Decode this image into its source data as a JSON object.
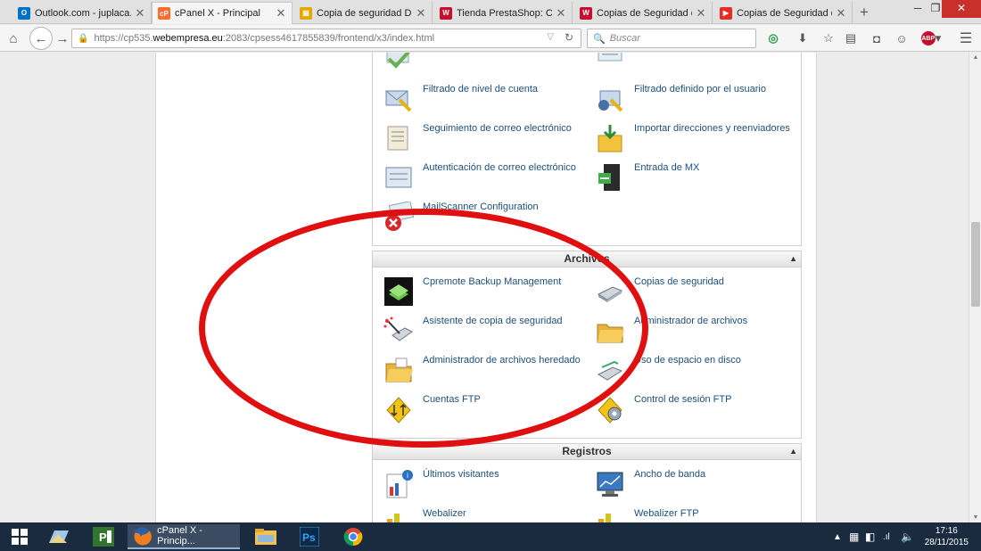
{
  "tabs": [
    {
      "title": "Outlook.com - juplaca...",
      "favicon": "outlook-icon",
      "color": "#0072c6",
      "glyph": "O"
    },
    {
      "title": "cPanel X - Principal",
      "favicon": "cpanel-icon",
      "color": "#ff6c2c",
      "glyph": "cP",
      "active": true
    },
    {
      "title": "Copia de seguridad DB ...",
      "favicon": "page-icon",
      "color": "#e0a800",
      "glyph": "▤"
    },
    {
      "title": "Tienda PrestaShop: Co...",
      "favicon": "webempresa-icon",
      "color": "#c8102e",
      "glyph": "W"
    },
    {
      "title": "Copias de Seguridad de...",
      "favicon": "webempresa-icon",
      "color": "#c8102e",
      "glyph": "W"
    },
    {
      "title": "Copias de Seguridad de...",
      "favicon": "youtube-icon",
      "color": "#e52d27",
      "glyph": "▶"
    }
  ],
  "browser": {
    "url_prefix": "https://cp535.",
    "url_host": "webempresa.eu",
    "url_rest": ":2083/cpsess4617855839/frontend/x3/index.html",
    "search_placeholder": "Buscar"
  },
  "email_section": {
    "items": [
      {
        "label": "Filtrado de nivel de cuenta",
        "icon": "filter-mail-icon"
      },
      {
        "label": "Filtrado definido por el usuario",
        "icon": "user-filter-icon"
      },
      {
        "label": "Seguimiento de correo electrónico",
        "icon": "mail-tracking-icon"
      },
      {
        "label": "Importar direcciones y reenviadores",
        "icon": "import-icon"
      },
      {
        "label": "Autenticación de correo electrónico",
        "icon": "mail-auth-icon"
      },
      {
        "label": "Entrada de MX",
        "icon": "mx-entry-icon"
      },
      {
        "label": "MailScanner Configuration",
        "icon": "mailscanner-icon"
      }
    ]
  },
  "archivos_section": {
    "title": "Archivos",
    "items": [
      {
        "label": "Cpremote Backup Management",
        "icon": "cpremote-backup-icon"
      },
      {
        "label": "Copias de seguridad",
        "icon": "backup-disk-icon"
      },
      {
        "label": "Asistente de copia de seguridad",
        "icon": "backup-wizard-icon"
      },
      {
        "label": "Administrador de archivos",
        "icon": "file-manager-icon"
      },
      {
        "label": "Administrador de archivos heredado",
        "icon": "legacy-file-manager-icon"
      },
      {
        "label": "Uso de espacio en disco",
        "icon": "disk-usage-icon"
      },
      {
        "label": "Cuentas FTP",
        "icon": "ftp-accounts-icon"
      },
      {
        "label": "Control de sesión FTP",
        "icon": "ftp-session-icon"
      }
    ]
  },
  "registros_section": {
    "title": "Registros",
    "items": [
      {
        "label": "Últimos visitantes",
        "icon": "latest-visitors-icon"
      },
      {
        "label": "Ancho de banda",
        "icon": "bandwidth-icon"
      },
      {
        "label": "Webalizer",
        "icon": "webalizer-icon"
      },
      {
        "label": "Webalizer FTP",
        "icon": "webalizer-ftp-icon"
      }
    ]
  },
  "taskbar": {
    "active_window": "cPanel X - Princip...",
    "time": "17:16",
    "date": "28/11/2015"
  }
}
